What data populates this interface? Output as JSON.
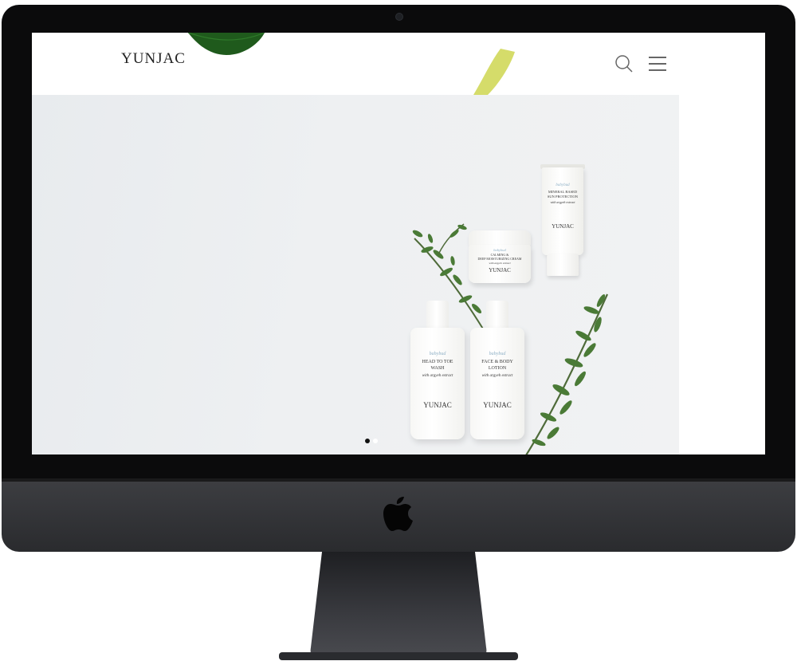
{
  "site": {
    "logo": "YUNJAC"
  },
  "header": {
    "search_icon": "search-icon",
    "menu_icon": "hamburger-menu-icon"
  },
  "hero": {
    "slide_count": 2,
    "active_slide": 1,
    "products": [
      {
        "script": "babybud",
        "name_line1": "MINERAL BASED",
        "name_line2": "SUN PROTECTION",
        "sub": "with argyeh extract",
        "brand": "YUNJAC"
      },
      {
        "script": "babybud",
        "name_line1": "CALMING &",
        "name_line2": "DEEP MOISTURIZING CREAM",
        "sub": "with argyeh extract",
        "brand": "YUNJAC"
      },
      {
        "script": "babybud",
        "name_line1": "HEAD TO TOE",
        "name_line2": "WASH",
        "sub": "with argyeh extract",
        "brand": "YUNJAC"
      },
      {
        "script": "babybud",
        "name_line1": "FACE & BODY",
        "name_line2": "LOTION",
        "sub": "with argyeh extract",
        "brand": "YUNJAC"
      }
    ]
  },
  "device": {
    "logo_icon": "apple-logo-icon"
  },
  "colors": {
    "bezel": "#0b0b0c",
    "chin": "#34353a",
    "leaf_dark": "#1f5a1c",
    "leaf_yellow": "#d7df4a",
    "dot_active": "#111111",
    "dot_inactive": "#ffffff"
  }
}
